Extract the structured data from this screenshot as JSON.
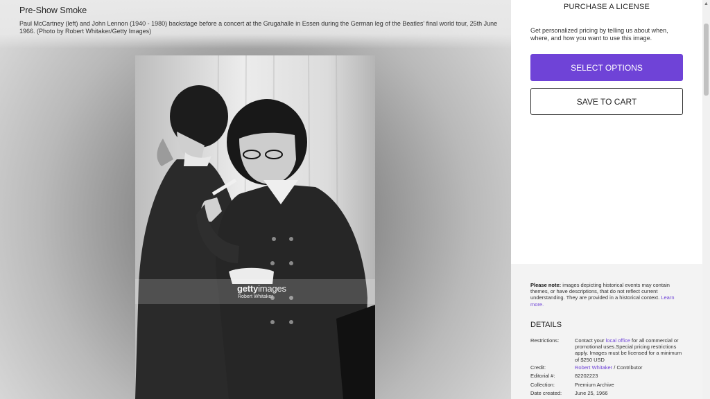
{
  "image": {
    "title": "Pre-Show Smoke",
    "caption": "Paul McCartney (left) and John Lennon (1940 - 1980) backstage before a concert at the Grugahalle in Essen during the German leg of the Beatles' final world tour, 25th June 1966. (Photo by Robert Whitaker/Getty Images)",
    "watermark_brand_bold": "getty",
    "watermark_brand_light": "images",
    "watermark_credit": "Robert Whitaker"
  },
  "license": {
    "title": "PURCHASE A LICENSE",
    "pricing_text": "Get personalized pricing by telling us about when, where, and how you want to use this image.",
    "select_options_label": "SELECT OPTIONS",
    "save_to_cart_label": "SAVE TO CART",
    "accent_color": "#6f43d7"
  },
  "note": {
    "label": "Please note:",
    "text": " images depicting historical events may contain themes, or have descriptions, that do not reflect current understanding. They are provided in a historical context. ",
    "link": "Learn more."
  },
  "details": {
    "title": "DETAILS",
    "restrictions_label": "Restrictions:",
    "restrictions_pre": "Contact your ",
    "restrictions_link": "local office",
    "restrictions_post": " for all commercial or promotional uses.Special pricing restrictions apply. Images must be licensed for a minimum of $250 USD",
    "credit_label": "Credit:",
    "credit_link": "Robert Whitaker",
    "credit_post": " / Contributor",
    "editorial_label": "Editorial #:",
    "editorial_value": "82202223",
    "collection_label": "Collection:",
    "collection_value": "Premium Archive",
    "date_label": "Date created:",
    "date_value": "June 25, 1966"
  }
}
